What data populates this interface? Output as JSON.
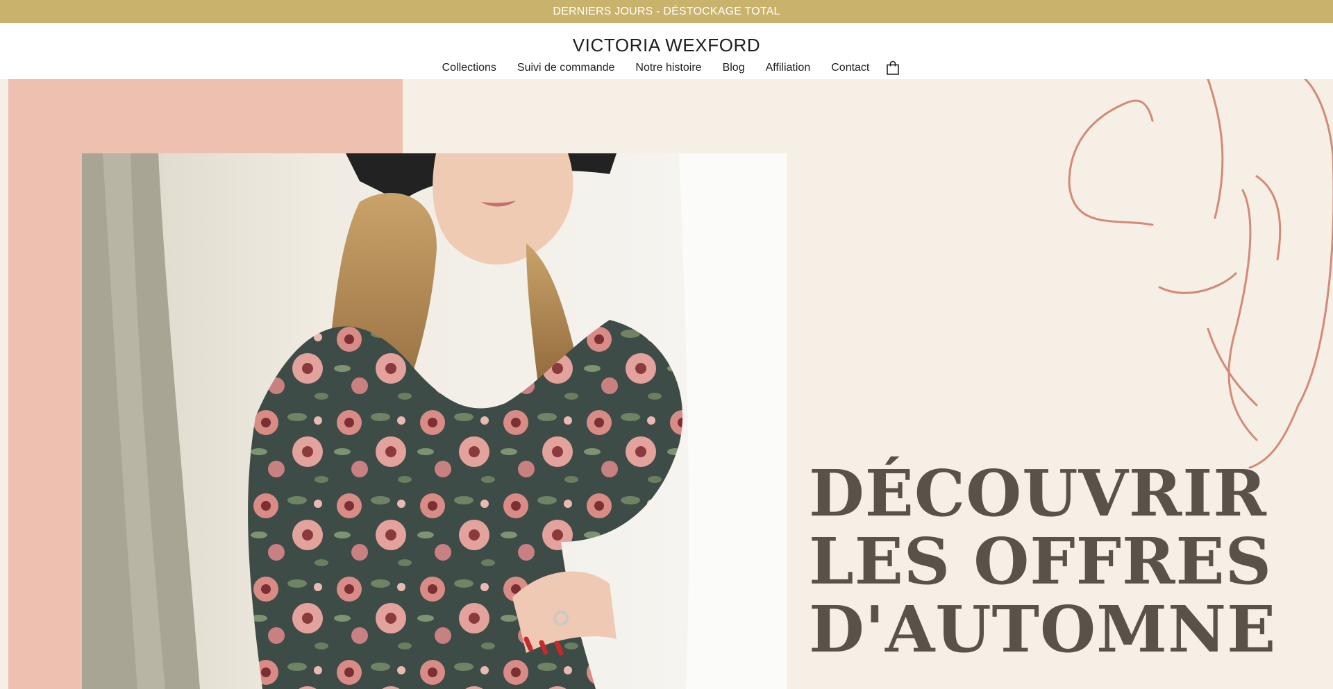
{
  "announcement": "DERNIERS JOURS - DÉSTOCKAGE TOTAL",
  "brand": "VICTORIA WEXFORD",
  "nav": {
    "items": [
      {
        "label": "Collections"
      },
      {
        "label": "Suivi de commande"
      },
      {
        "label": "Notre histoire"
      },
      {
        "label": "Blog"
      },
      {
        "label": "Affiliation"
      },
      {
        "label": "Contact"
      }
    ],
    "cart_icon": "shopping-bag-icon"
  },
  "hero": {
    "title_lines": [
      "DÉCOUVRIR",
      "LES OFFRES",
      "D'AUTOMNE"
    ],
    "colors": {
      "background": "#f6efe5",
      "pink_block": "#eec0b0",
      "title": "#58524b",
      "doodle": "#d38a76",
      "announcement_bar": "#c9b26b"
    },
    "image_alt": "woman in floral dress with hat"
  }
}
